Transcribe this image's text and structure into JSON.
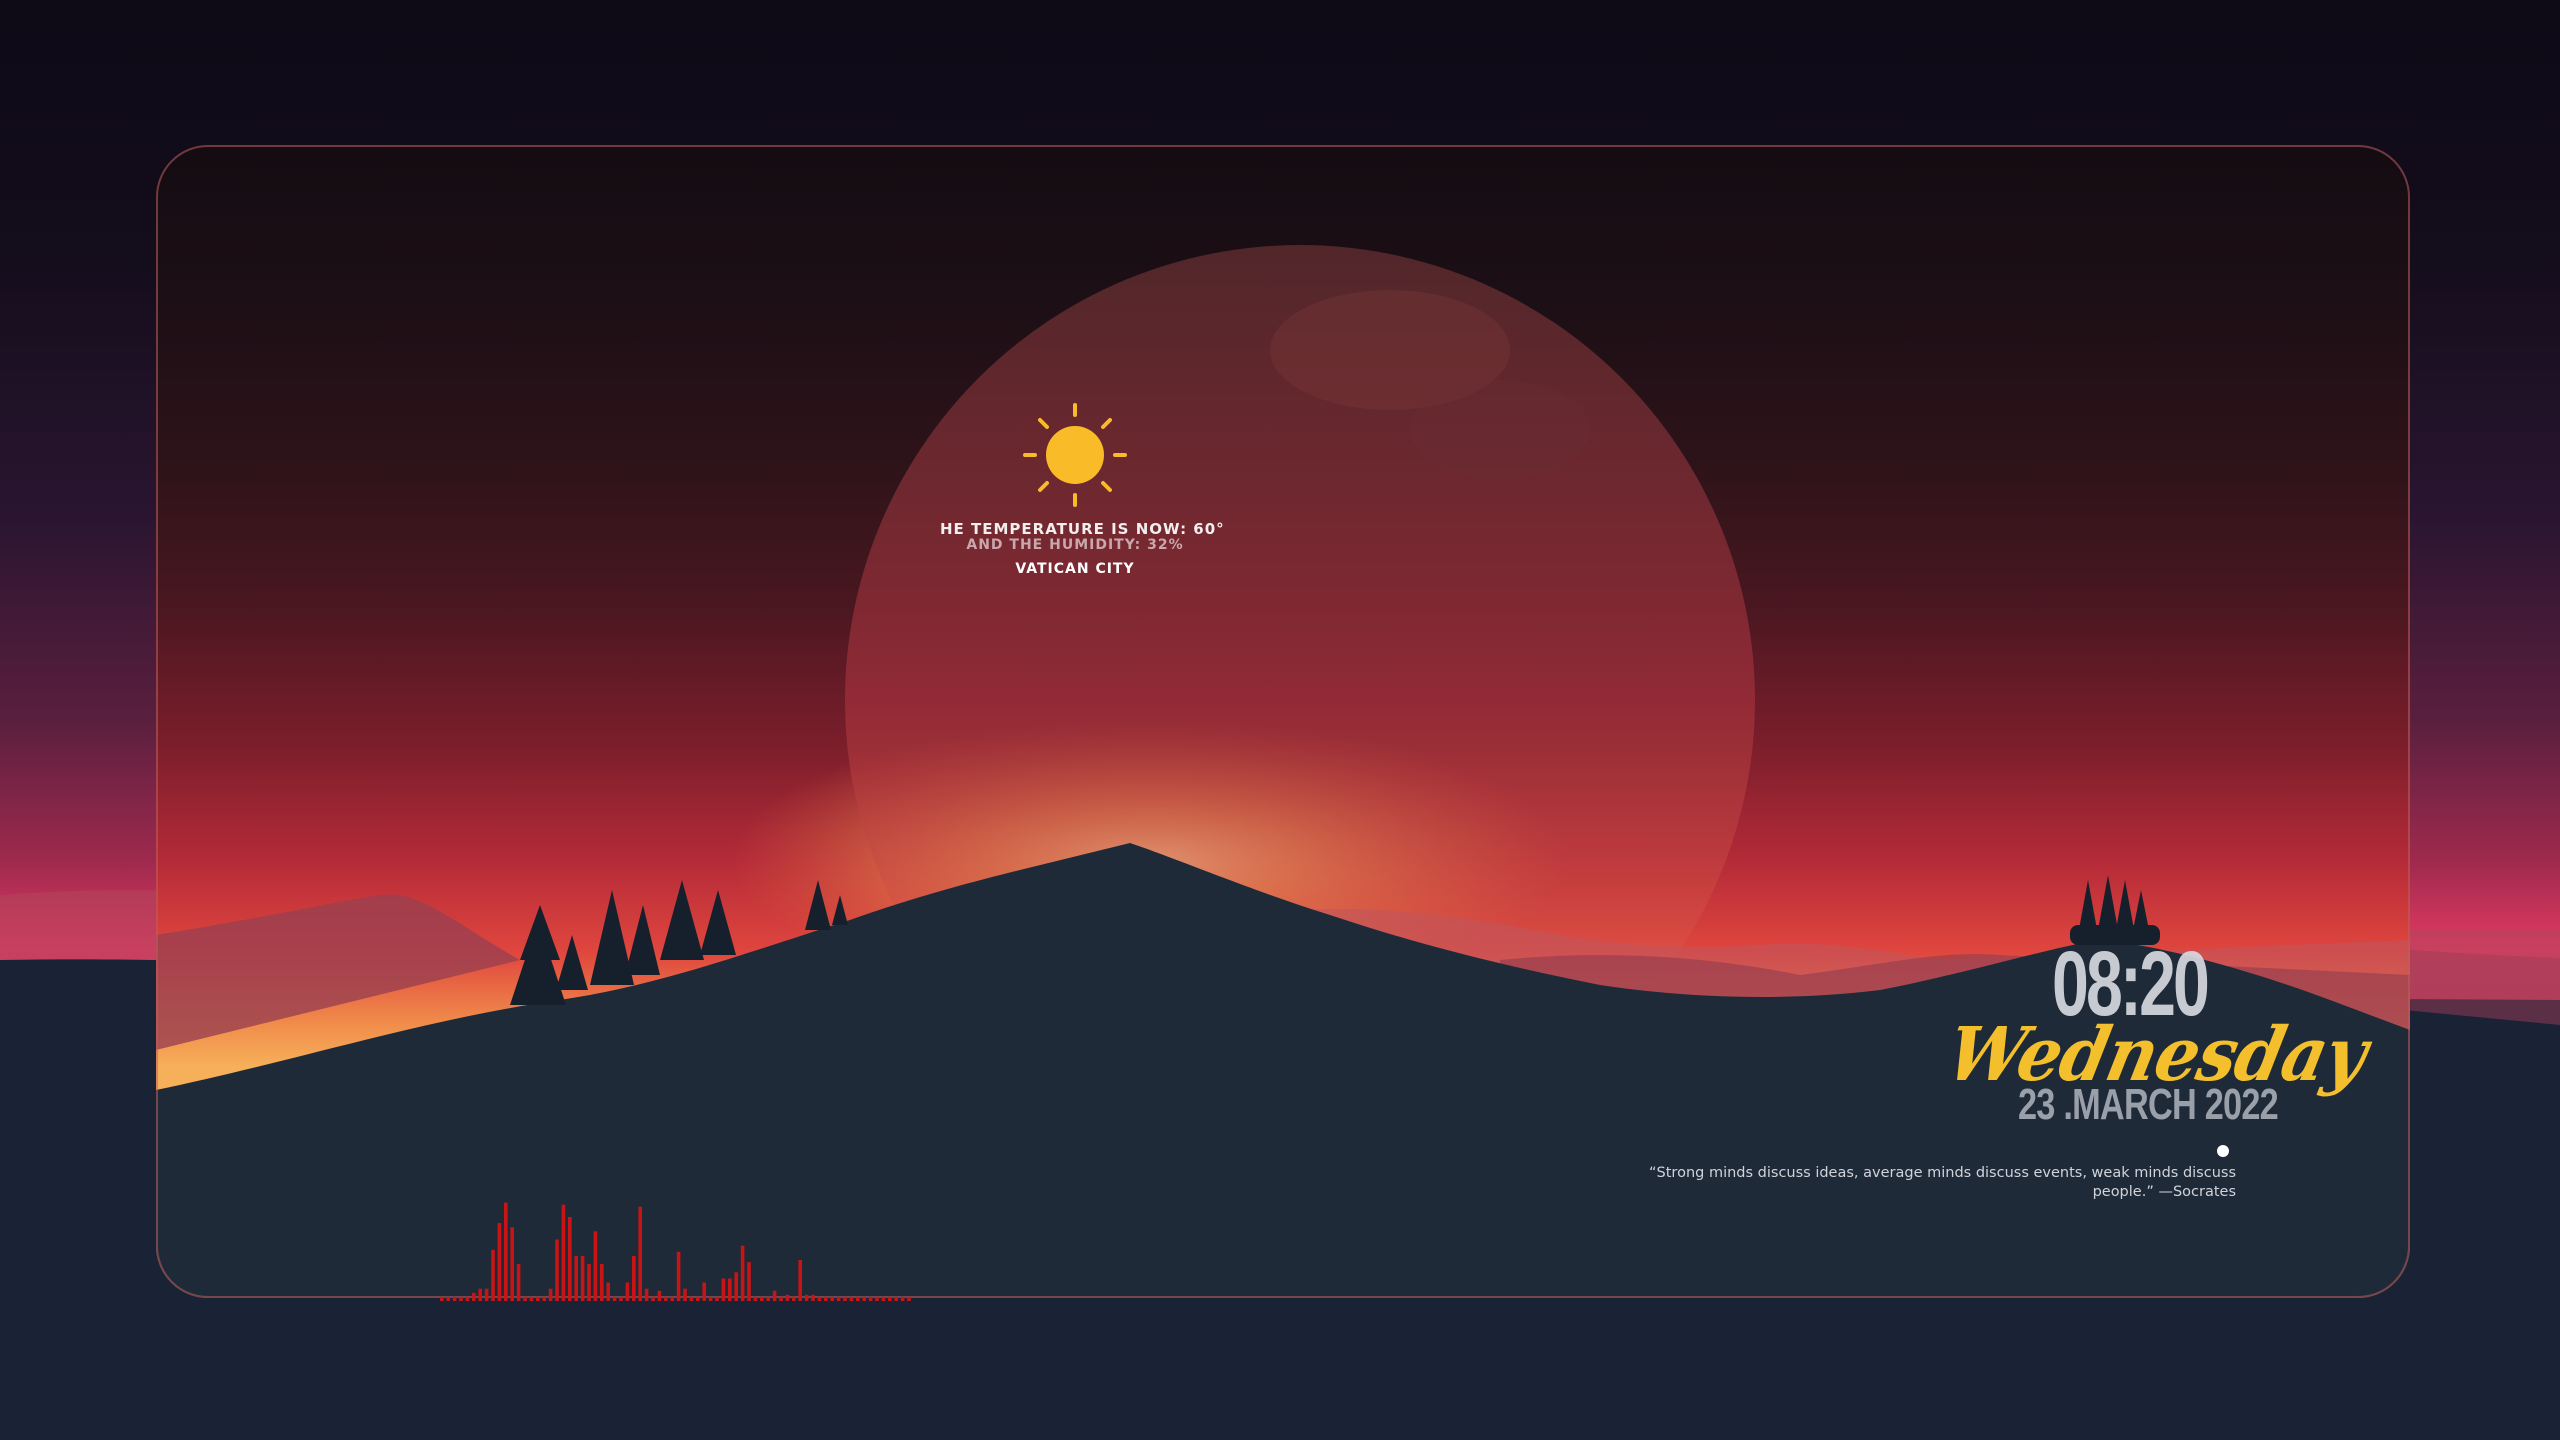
{
  "weather": {
    "icon": "sun-icon",
    "temperature_text": "HE TEMPERATURE IS NOW: 60°",
    "humidity_text": "AND THE HUMIDITY: 32%",
    "city": "VATICAN CITY"
  },
  "clock": {
    "time": "08:20",
    "weekday": "Wednesday",
    "date": "23 .MARCH 2022"
  },
  "quote": {
    "text": "“Strong minds discuss ideas, average minds discuss events, weak minds discuss people.” —Socrates"
  },
  "visualizer": {
    "color": "#c81414",
    "levels": [
      0.02,
      0.02,
      0.02,
      0.02,
      0.02,
      0.04,
      0.06,
      0.06,
      0.25,
      0.38,
      0.48,
      0.36,
      0.18,
      0.02,
      0.02,
      0.02,
      0.02,
      0.06,
      0.3,
      0.47,
      0.41,
      0.22,
      0.22,
      0.18,
      0.34,
      0.18,
      0.09,
      0.02,
      0.02,
      0.09,
      0.22,
      0.46,
      0.06,
      0.02,
      0.05,
      0.02,
      0.02,
      0.24,
      0.06,
      0.02,
      0.02,
      0.09,
      0.02,
      0.02,
      0.11,
      0.11,
      0.14,
      0.27,
      0.19,
      0.02,
      0.02,
      0.02,
      0.05,
      0.02,
      0.03,
      0.02,
      0.2,
      0.03,
      0.03,
      0.02,
      0.02,
      0.02,
      0.02,
      0.02,
      0.02,
      0.02,
      0.02,
      0.02,
      0.02,
      0.02,
      0.02,
      0.02,
      0.02,
      0.02
    ]
  },
  "colors": {
    "frame_border": "#be5f5f",
    "weekday_accent": "#f3bf2c",
    "sun": "#f9bb28"
  }
}
